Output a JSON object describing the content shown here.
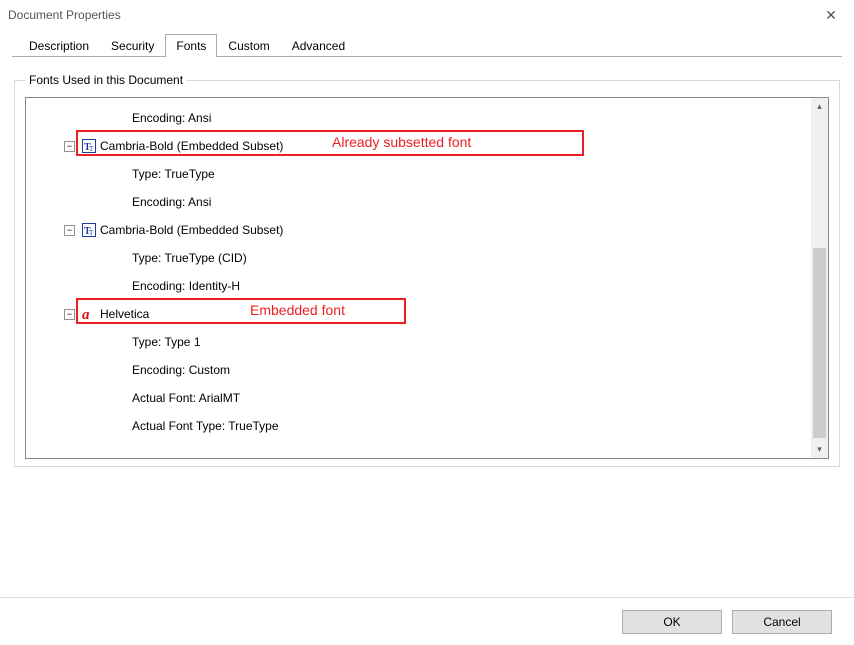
{
  "window": {
    "title": "Document Properties"
  },
  "tabs": {
    "items": [
      {
        "label": "Description"
      },
      {
        "label": "Security"
      },
      {
        "label": "Fonts"
      },
      {
        "label": "Custom"
      },
      {
        "label": "Advanced"
      }
    ],
    "active_index": 2
  },
  "groupbox": {
    "legend": "Fonts Used in this Document"
  },
  "fonts_tree": [
    {
      "name": "__offscreen_above__",
      "details": [
        {
          "label": "Encoding: Ansi"
        }
      ]
    },
    {
      "name": "Cambria-Bold (Embedded Subset)",
      "icon": "truetype-icon",
      "expanded": true,
      "details": [
        {
          "label": "Type: TrueType"
        },
        {
          "label": "Encoding: Ansi"
        }
      ]
    },
    {
      "name": "Cambria-Bold (Embedded Subset)",
      "icon": "truetype-icon",
      "expanded": true,
      "details": [
        {
          "label": "Type: TrueType (CID)"
        },
        {
          "label": "Encoding: Identity-H"
        }
      ]
    },
    {
      "name": "Helvetica",
      "icon": "type1-icon",
      "expanded": true,
      "details": [
        {
          "label": "Type: Type 1"
        },
        {
          "label": "Encoding: Custom"
        },
        {
          "label": "Actual Font: ArialMT"
        },
        {
          "label": "Actual Font Type: TrueType"
        }
      ]
    }
  ],
  "annotations": {
    "one": "Already subsetted font",
    "two": "Embedded font"
  },
  "toggle_glyph": {
    "minus": "−",
    "plus": "+"
  },
  "buttons": {
    "ok": "OK",
    "cancel": "Cancel"
  },
  "icons": {
    "close": "✕",
    "up": "▴",
    "down": "▾"
  }
}
